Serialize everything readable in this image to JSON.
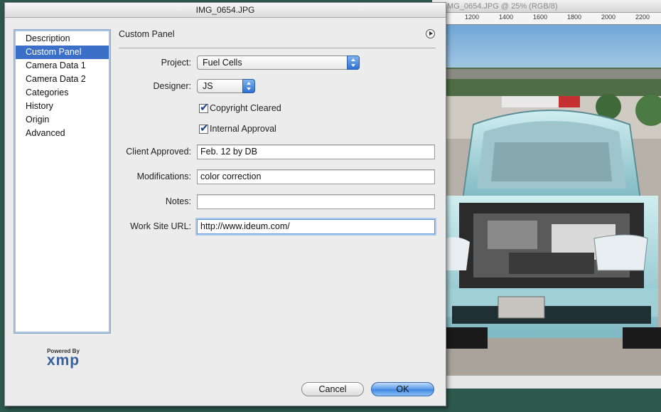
{
  "background_window": {
    "title": "IMG_0654.JPG @ 25% (RGB/8)",
    "ruler_ticks": [
      "1200",
      "1400",
      "1600",
      "1800",
      "2000",
      "2200"
    ]
  },
  "dialog": {
    "title": "IMG_0654.JPG",
    "categories": [
      "Description",
      "Custom Panel",
      "Camera Data 1",
      "Camera Data 2",
      "Categories",
      "History",
      "Origin",
      "Advanced"
    ],
    "selected_category": "Custom Panel",
    "powered_by": "Powered By",
    "logo_text": "xmp"
  },
  "panel": {
    "title": "Custom Panel",
    "project_label": "Project:",
    "project_value": "Fuel Cells",
    "designer_label": "Designer:",
    "designer_value": "JS",
    "copyright_label": "Copyright Cleared",
    "copyright_checked": true,
    "approval_label": "Internal Approval",
    "approval_checked": true,
    "client_approved_label": "Client Approved:",
    "client_approved_value": "Feb. 12 by DB",
    "modifications_label": "Modifications:",
    "modifications_value": "color correction",
    "notes_label": "Notes:",
    "notes_value": "",
    "url_label": "Work Site URL:",
    "url_value": "http://www.ideum.com/"
  },
  "buttons": {
    "cancel": "Cancel",
    "ok": "OK"
  },
  "colors": {
    "selection": "#3c6fc8",
    "desktop": "#2e5a4e",
    "ok_button": "#3d86e0"
  }
}
